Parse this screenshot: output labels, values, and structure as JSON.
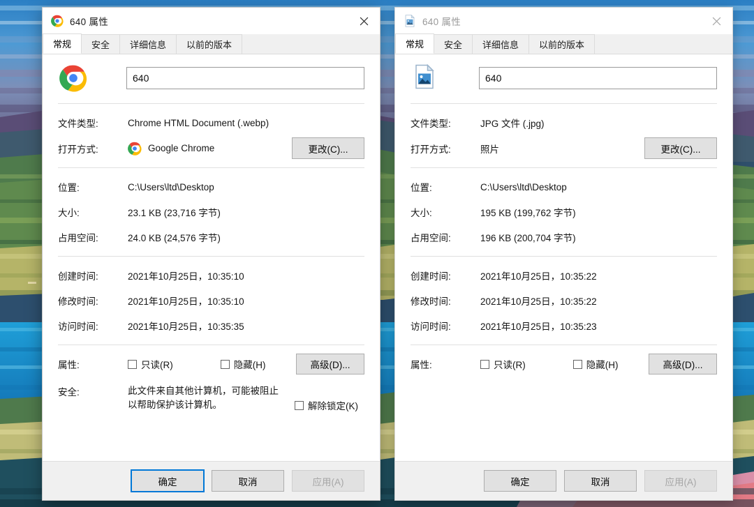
{
  "wallpaper": {
    "name": "painted-landscape-wallpaper",
    "colors": [
      "#1d3f6b",
      "#3a86c8",
      "#6e7fa8",
      "#7d5f86",
      "#4e7a4a",
      "#8fa64e",
      "#c9c474",
      "#2a5fa0",
      "#1b8fd0",
      "#e0726a",
      "#d98fa8"
    ]
  },
  "windows": [
    {
      "id": "left",
      "active": true,
      "titlebar": {
        "icon": "chrome-icon",
        "title": "640 属性",
        "close_label": "关闭"
      },
      "tabs": [
        {
          "label": "常规",
          "active": true
        },
        {
          "label": "安全",
          "active": false
        },
        {
          "label": "详细信息",
          "active": false
        },
        {
          "label": "以前的版本",
          "active": false
        }
      ],
      "header": {
        "icon": "chrome-icon",
        "filename_value": "640"
      },
      "info": [
        {
          "label": "文件类型:",
          "value": "Chrome HTML Document (.webp)",
          "icon": null
        },
        {
          "label": "打开方式:",
          "value": "Google Chrome",
          "icon": "chrome-icon",
          "button": "更改(C)..."
        }
      ],
      "location": [
        {
          "label": "位置:",
          "value": "C:\\Users\\ltd\\Desktop"
        },
        {
          "label": "大小:",
          "value": "23.1 KB (23,716 字节)"
        },
        {
          "label": "占用空间:",
          "value": "24.0 KB (24,576 字节)"
        }
      ],
      "times": [
        {
          "label": "创建时间:",
          "value": "2021年10月25日，10:35:10"
        },
        {
          "label": "修改时间:",
          "value": "2021年10月25日，10:35:10"
        },
        {
          "label": "访问时间:",
          "value": "2021年10月25日，10:35:35"
        }
      ],
      "attributes": {
        "label": "属性:",
        "readonly_label": "只读(R)",
        "readonly_checked": false,
        "hidden_label": "隐藏(H)",
        "hidden_checked": false,
        "advanced_button": "高级(D)..."
      },
      "security": {
        "label": "安全:",
        "text": "此文件来自其他计算机，可能被阻止以帮助保护该计算机。",
        "unblock_label": "解除锁定(K)",
        "unblock_checked": false
      },
      "footer": {
        "ok": "确定",
        "cancel": "取消",
        "apply": "应用(A)",
        "apply_disabled": true,
        "ok_is_default": true
      }
    },
    {
      "id": "right",
      "active": false,
      "titlebar": {
        "icon": "image-file-icon",
        "title": "640 属性",
        "close_label": "关闭"
      },
      "tabs": [
        {
          "label": "常规",
          "active": true
        },
        {
          "label": "安全",
          "active": false
        },
        {
          "label": "详细信息",
          "active": false
        },
        {
          "label": "以前的版本",
          "active": false
        }
      ],
      "header": {
        "icon": "image-file-icon",
        "filename_value": "640"
      },
      "info": [
        {
          "label": "文件类型:",
          "value": "JPG 文件 (.jpg)",
          "icon": null
        },
        {
          "label": "打开方式:",
          "value": "照片",
          "icon": null,
          "button": "更改(C)..."
        }
      ],
      "location": [
        {
          "label": "位置:",
          "value": "C:\\Users\\ltd\\Desktop"
        },
        {
          "label": "大小:",
          "value": "195 KB (199,762 字节)"
        },
        {
          "label": "占用空间:",
          "value": "196 KB (200,704 字节)"
        }
      ],
      "times": [
        {
          "label": "创建时间:",
          "value": "2021年10月25日，10:35:22"
        },
        {
          "label": "修改时间:",
          "value": "2021年10月25日，10:35:22"
        },
        {
          "label": "访问时间:",
          "value": "2021年10月25日，10:35:23"
        }
      ],
      "attributes": {
        "label": "属性:",
        "readonly_label": "只读(R)",
        "readonly_checked": false,
        "hidden_label": "隐藏(H)",
        "hidden_checked": false,
        "advanced_button": "高级(D)..."
      },
      "security": null,
      "footer": {
        "ok": "确定",
        "cancel": "取消",
        "apply": "应用(A)",
        "apply_disabled": true,
        "ok_is_default": false
      }
    }
  ],
  "colors": {
    "accent": "#0078d7",
    "button_face": "#e1e1e1",
    "button_border": "#adadad",
    "text": "#161616",
    "disabled_text": "#a6a6a6",
    "inactive_title": "#9a9a9a"
  }
}
